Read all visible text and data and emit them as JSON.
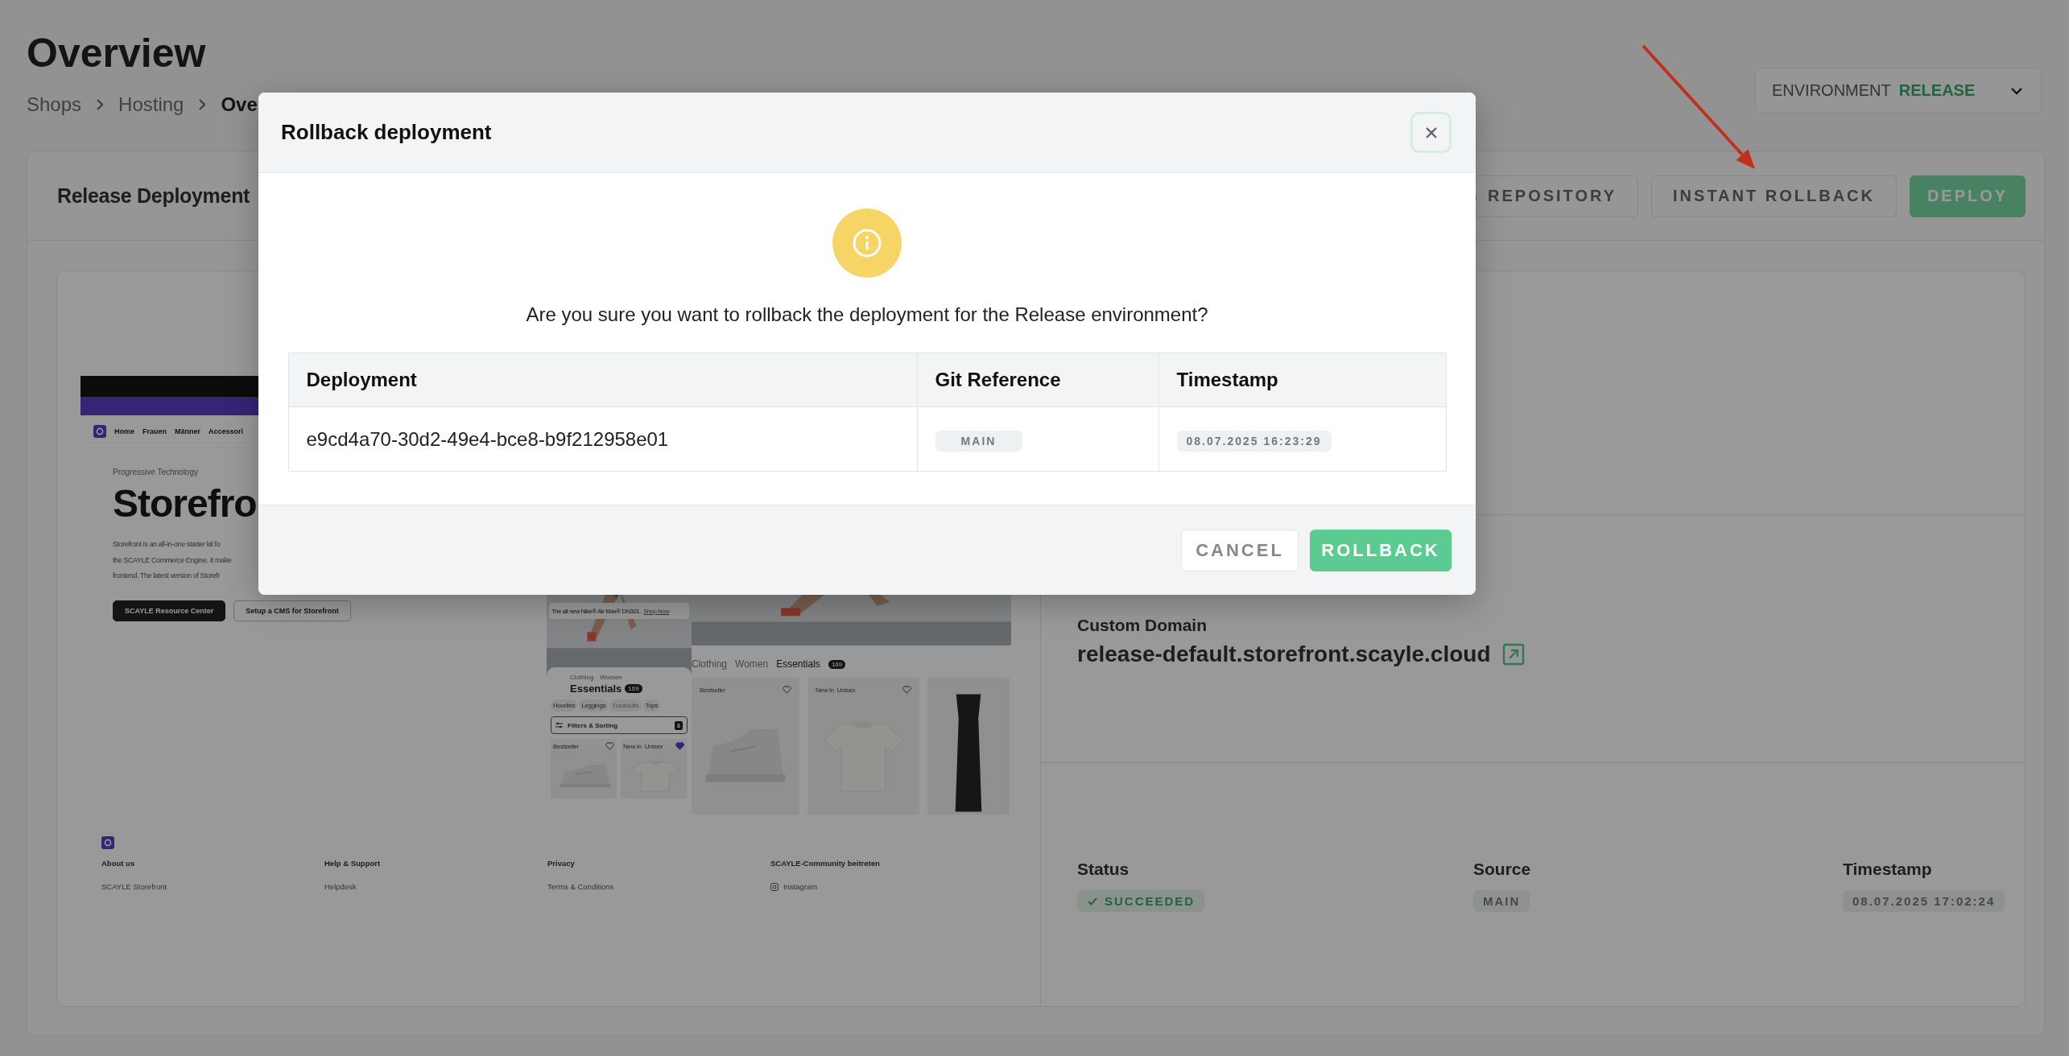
{
  "page": {
    "title": "Overview",
    "breadcrumb": [
      {
        "label": "Shops",
        "current": false
      },
      {
        "label": "Hosting",
        "current": false
      },
      {
        "label": "Ove",
        "current": true
      }
    ]
  },
  "environment_select": {
    "label": "ENVIRONMENT",
    "value": "RELEASE"
  },
  "deployment_card": {
    "title": "Release Deployment",
    "actions": [
      {
        "label": "REPOSITORY",
        "kind": "repository"
      },
      {
        "label": "INSTANT ROLLBACK",
        "kind": "outline"
      },
      {
        "label": "DEPLOY",
        "kind": "primary"
      }
    ],
    "preview": {
      "nav": [
        "Home",
        "Frauen",
        "Männer",
        "Accessori"
      ],
      "eyebrow": "Progressive Technology",
      "heading": "Storefro",
      "lines": [
        "Storefront is an all-in-one starter kit fo",
        "the SCAYLE Commerce Engine. It make",
        "frontend. The latest version of Storefr"
      ],
      "buttons": [
        {
          "label": "SCAYLE Resource Center",
          "kind": "dark"
        },
        {
          "label": "Setup a CMS for Storefront",
          "kind": "outline"
        }
      ],
      "mobile": {
        "banner": "The all new Nike® Air Max® DN301.",
        "banner_link": "Shop Now",
        "crumbs": [
          "Clothing",
          "Women"
        ],
        "title": "Essentials",
        "count": "169",
        "chips": [
          {
            "label": "Hoodies",
            "disabled": false
          },
          {
            "label": "Leggings",
            "disabled": false
          },
          {
            "label": "Tracksuits",
            "disabled": true
          },
          {
            "label": "Tops",
            "disabled": false
          }
        ],
        "filter": "Filters & Sorting",
        "filter_count": "3",
        "products": [
          {
            "tags": [
              "Bestseller"
            ],
            "favorite": false
          },
          {
            "tags": [
              "New in",
              "Unisex"
            ],
            "favorite": true
          }
        ]
      },
      "desktop": {
        "crumbs": [
          "Clothing",
          "Women",
          "Essentials"
        ],
        "count": "169",
        "products": [
          {
            "tags": [
              "Bestseller"
            ],
            "favorite": false
          },
          {
            "tags": [
              "New in",
              "Unisex"
            ],
            "favorite": false
          },
          {
            "kind": "picture"
          }
        ]
      },
      "footer": [
        {
          "heading": "About us",
          "link": "SCAYLE Storefront",
          "kind": "text"
        },
        {
          "heading": "Help & Support",
          "link": "Helpdesk",
          "kind": "text"
        },
        {
          "heading": "Privacy",
          "link": "Terms & Conditions",
          "kind": "text"
        },
        {
          "heading": "SCAYLE-Community beitreten",
          "link": "Instagram",
          "kind": "social"
        }
      ]
    },
    "custom_domain": {
      "label": "Custom Domain",
      "value": "release-default.storefront.scayle.cloud"
    },
    "details": [
      {
        "label": "Status",
        "value": "SUCCEEDED",
        "kind": "status"
      },
      {
        "label": "Source",
        "value": "MAIN",
        "kind": "tag"
      },
      {
        "label": "Timestamp",
        "value": "08.07.2025 17:02:24",
        "kind": "tag"
      }
    ]
  },
  "modal": {
    "title": "Rollback deployment",
    "message": "Are you sure you want to rollback the deployment for the Release environment?",
    "table": {
      "columns": [
        "Deployment",
        "Git Reference",
        "Timestamp"
      ],
      "rows": [
        {
          "deployment": "e9cd4a70-30d2-49e4-bce8-b9f212958e01",
          "git_reference": "MAIN",
          "timestamp": "08.07.2025 16:23:29"
        }
      ]
    },
    "buttons": [
      {
        "label": "CANCEL",
        "kind": "secondary"
      },
      {
        "label": "ROLLBACK",
        "kind": "primary"
      }
    ]
  }
}
